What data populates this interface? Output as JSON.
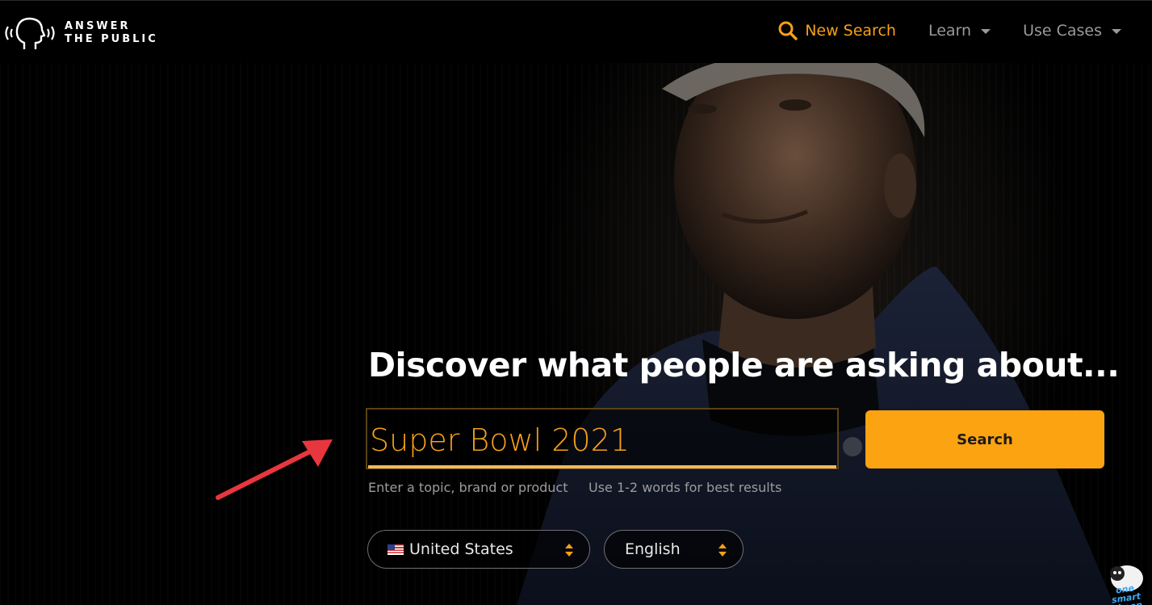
{
  "brand": {
    "line1": "ANSWER",
    "line2": "THE PUBLIC"
  },
  "nav": {
    "new_search": "New Search",
    "learn": "Learn",
    "use_cases": "Use Cases"
  },
  "hero": {
    "headline": "Discover what people are asking about..."
  },
  "search": {
    "value": "Super Bowl 2021",
    "button_label": "Search",
    "hint_left": "Enter a topic, brand or product",
    "hint_right": "Use 1-2 words for best results"
  },
  "filters": {
    "country": "United States",
    "language": "English"
  },
  "watermark": {
    "text": "one smart sheep"
  },
  "colors": {
    "accent": "#fca311",
    "accent_text": "#f5a019",
    "muted": "#9a9a9a",
    "annotation_arrow": "#e8363f"
  },
  "icons": {
    "logo": "speaking-head-icon",
    "nav_search": "search-icon",
    "dropdown": "chevron-down-icon",
    "select_toggle": "updown-icon",
    "flag": "us-flag-icon"
  }
}
